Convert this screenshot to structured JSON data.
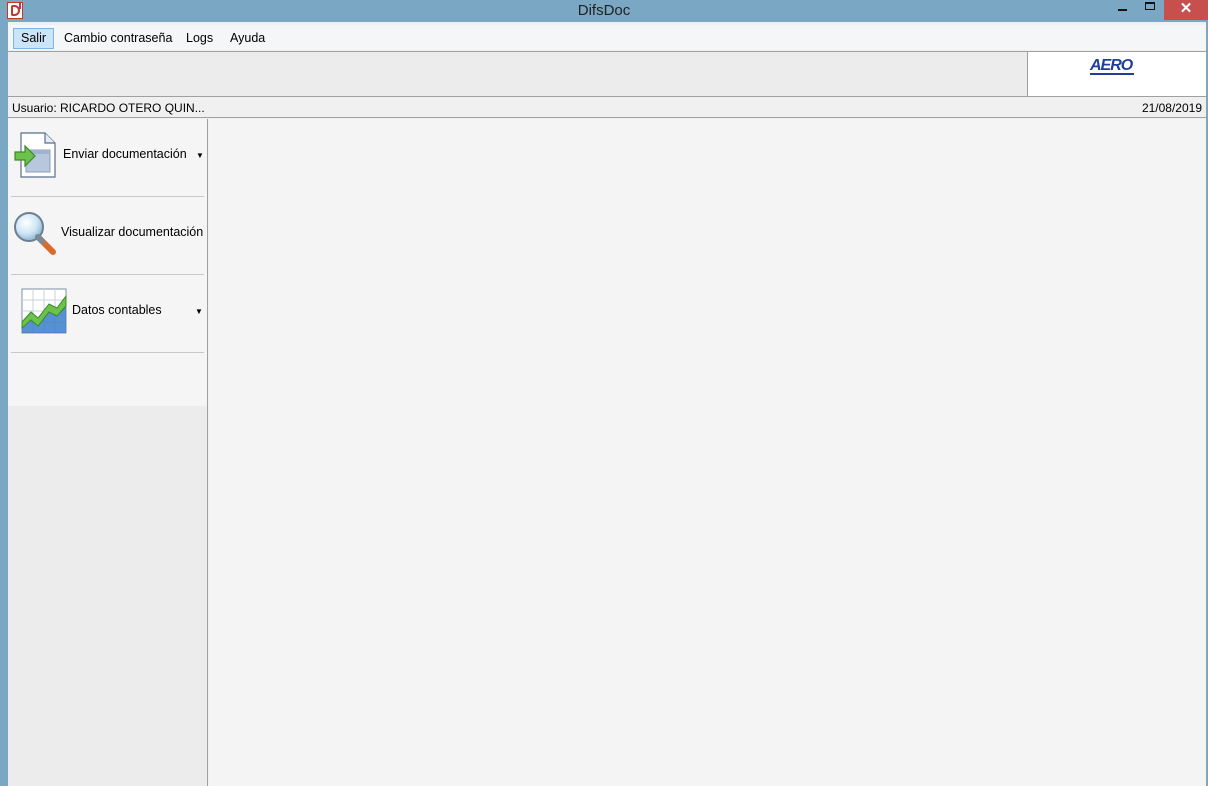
{
  "window": {
    "title": "DifsDoc",
    "close_glyph": "✕",
    "icons": [
      "app-icon",
      "minimize-icon",
      "maximize-icon",
      "close-icon"
    ]
  },
  "menu": {
    "items": [
      "Salir",
      "Cambio contraseña",
      "Logs",
      "Ayuda"
    ]
  },
  "header": {
    "logo_text": "AERO"
  },
  "status": {
    "user": "Usuario: RICARDO OTERO QUIN...",
    "date": "21/08/2019"
  },
  "nav": {
    "items": [
      {
        "label": "Enviar documentación",
        "icon": "send-document-icon",
        "has_dropdown": true
      },
      {
        "label": "Visualizar documentación",
        "icon": "magnifier-icon",
        "has_dropdown": false
      },
      {
        "label": "Datos contables",
        "icon": "chart-icon",
        "has_dropdown": true
      }
    ],
    "dropdown_glyph": "▼"
  },
  "colors": {
    "titlebar": "#7aa7c3",
    "close_button": "#c7504f",
    "menu_active": "#cce4f7",
    "logo_blue": "#1f3f9a"
  }
}
